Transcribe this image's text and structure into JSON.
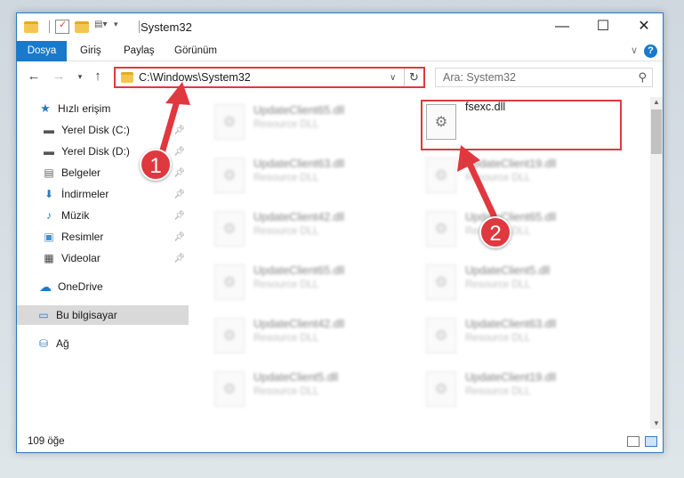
{
  "window": {
    "title": "System32"
  },
  "ribbon": {
    "tabs": [
      "Dosya",
      "Giriş",
      "Paylaş",
      "Görünüm"
    ],
    "help": "?"
  },
  "address": {
    "path": "C:\\Windows\\System32",
    "refresh_icon": "↻"
  },
  "search": {
    "placeholder": "Ara: System32"
  },
  "sidebar": {
    "items": [
      {
        "label": "Hızlı erişim",
        "icon": "star-icon"
      },
      {
        "label": "Yerel Disk (C:)",
        "icon": "drive-icon"
      },
      {
        "label": "Yerel Disk (D:)",
        "icon": "drive-icon"
      },
      {
        "label": "Belgeler",
        "icon": "documents-icon"
      },
      {
        "label": "İndirmeler",
        "icon": "download-icon"
      },
      {
        "label": "Müzik",
        "icon": "music-icon"
      },
      {
        "label": "Resimler",
        "icon": "pictures-icon"
      },
      {
        "label": "Videolar",
        "icon": "video-icon"
      },
      {
        "label": "OneDrive",
        "icon": "cloud-icon"
      },
      {
        "label": "Bu bilgisayar",
        "icon": "computer-icon"
      },
      {
        "label": "Ağ",
        "icon": "network-icon"
      }
    ]
  },
  "files": {
    "highlighted": {
      "name": "fsexc.dll"
    },
    "blurred_left": [
      {
        "name": "UpdateClient65.dll",
        "type": "Resource DLL"
      },
      {
        "name": "UpdateClient63.dll",
        "type": "Resource DLL"
      },
      {
        "name": "UpdateClient42.dll",
        "type": "Resource DLL"
      },
      {
        "name": "UpdateClient65.dll",
        "type": "Resource DLL"
      },
      {
        "name": "UpdateClient42.dll",
        "type": "Resource DLL"
      },
      {
        "name": "UpdateClient5.dll",
        "type": "Resource DLL"
      }
    ],
    "blurred_right": [
      {
        "name": "UpdateClient19.dll",
        "type": "Resource DLL"
      },
      {
        "name": "UpdateClient65.dll",
        "type": "Resource DLL"
      },
      {
        "name": "UpdateClient5.dll",
        "type": "Resource DLL"
      },
      {
        "name": "UpdateClient63.dll",
        "type": "Resource DLL"
      },
      {
        "name": "UpdateClient19.dll",
        "type": "Resource DLL"
      }
    ]
  },
  "status": {
    "count": "109 öğe"
  },
  "callouts": [
    "1",
    "2"
  ],
  "colors": {
    "accent": "#1979ca",
    "highlight": "#e0383f"
  }
}
